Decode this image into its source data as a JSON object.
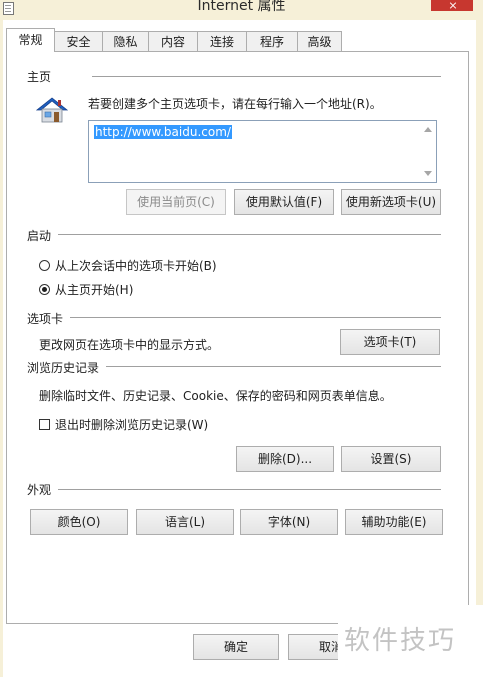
{
  "window": {
    "title": "Internet 属性"
  },
  "tabs": [
    {
      "label": "常规",
      "active": true
    },
    {
      "label": "安全"
    },
    {
      "label": "隐私"
    },
    {
      "label": "内容"
    },
    {
      "label": "连接"
    },
    {
      "label": "程序"
    },
    {
      "label": "高级"
    }
  ],
  "homepage": {
    "group_label": "主页",
    "icon": "house-icon",
    "instruction": "若要创建多个主页选项卡，请在每行输入一个地址(R)。",
    "url": "http://www.baidu.com/",
    "use_current_label": "使用当前页(C)",
    "use_default_label": "使用默认值(F)",
    "use_new_tab_label": "使用新选项卡(U)"
  },
  "startup": {
    "group_label": "启动",
    "option_last_session": "从上次会话中的选项卡开始(B)",
    "option_home_page": "从主页开始(H)",
    "selected": "option_home_page"
  },
  "tabs_group": {
    "group_label": "选项卡",
    "description": "更改网页在选项卡中的显示方式。",
    "button_label": "选项卡(T)"
  },
  "history": {
    "group_label": "浏览历史记录",
    "description": "删除临时文件、历史记录、Cookie、保存的密码和网页表单信息。",
    "delete_on_exit_label": "退出时删除浏览历史记录(W)",
    "delete_on_exit_checked": false,
    "delete_label": "删除(D)...",
    "settings_label": "设置(S)"
  },
  "appearance": {
    "group_label": "外观",
    "colors_label": "颜色(O)",
    "languages_label": "语言(L)",
    "fonts_label": "字体(N)",
    "accessibility_label": "辅助功能(E)"
  },
  "footer": {
    "ok_label": "确定",
    "cancel_label": "取消"
  },
  "watermark": "软件技巧",
  "colors": {
    "titlebar": "#f6f0d8",
    "close": "#c7372f",
    "selection": "#3399ff"
  }
}
